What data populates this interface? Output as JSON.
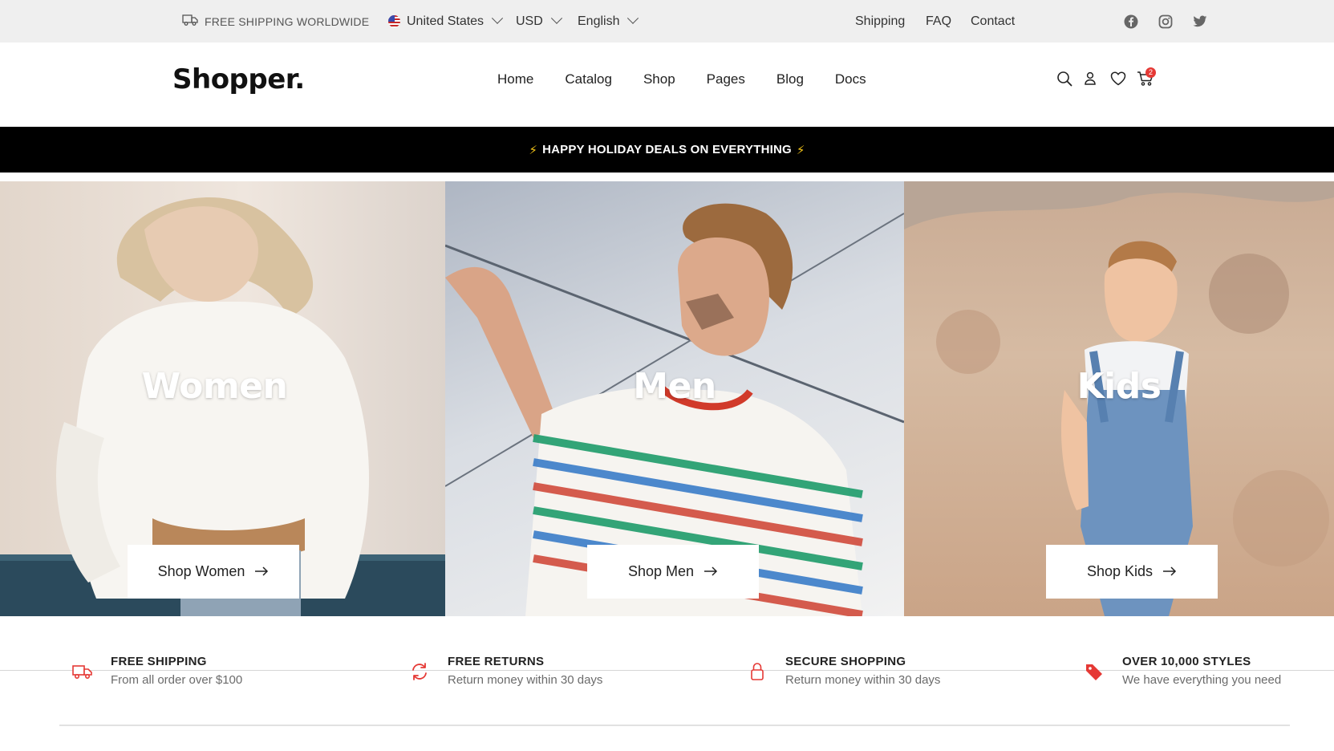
{
  "topbar": {
    "shipping_notice": "FREE SHIPPING WORLDWIDE",
    "country": "United States",
    "currency": "USD",
    "language": "English",
    "links": [
      "Shipping",
      "FAQ",
      "Contact"
    ],
    "social_icons": [
      "facebook-icon",
      "instagram-icon",
      "twitter-icon"
    ]
  },
  "header": {
    "logo": "Shopper.",
    "nav": [
      "Home",
      "Catalog",
      "Shop",
      "Pages",
      "Blog",
      "Docs"
    ],
    "icons": [
      "search-icon",
      "user-icon",
      "heart-icon",
      "cart-icon"
    ],
    "cart_count": "2"
  },
  "promo": {
    "text": "HAPPY HOLIDAY DEALS ON EVERYTHING"
  },
  "categories": [
    {
      "title": "Women",
      "button": "Shop Women"
    },
    {
      "title": "Men",
      "button": "Shop Men"
    },
    {
      "title": "Kids",
      "button": "Shop Kids"
    }
  ],
  "features": [
    {
      "title": "FREE SHIPPING",
      "subtitle": "From all order over $100",
      "icon": "truck-icon"
    },
    {
      "title": "FREE RETURNS",
      "subtitle": "Return money within 30 days",
      "icon": "refresh-icon"
    },
    {
      "title": "SECURE SHOPPING",
      "subtitle": "Return money within 30 days",
      "icon": "lock-icon"
    },
    {
      "title": "OVER 10,000 STYLES",
      "subtitle": "We have everything you need",
      "icon": "tag-icon"
    }
  ],
  "colors": {
    "accent": "#e53935",
    "promo_bg": "#000000",
    "topbar_bg": "#efefef"
  }
}
